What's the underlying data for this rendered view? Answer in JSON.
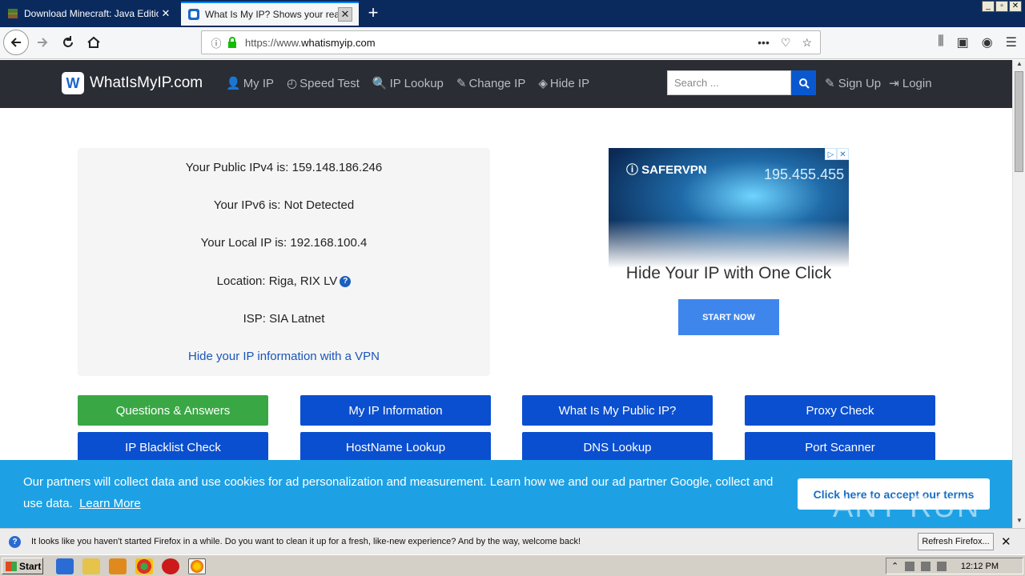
{
  "browser": {
    "tabs": [
      {
        "title": "Download Minecraft: Java Edition",
        "active": false
      },
      {
        "title": "What Is My IP? Shows your real pu",
        "active": true
      }
    ],
    "new_tab": "+",
    "url_prefix": "https://www.",
    "url_host": "whatismyip.com",
    "page_actions": "•••",
    "window_controls": [
      "_",
      "▫",
      "✕"
    ]
  },
  "site": {
    "logo_text": "WhatIsMyIP.com",
    "logo_mark": "W",
    "menu": [
      "My IP",
      "Speed Test",
      "IP Lookup",
      "Change IP",
      "Hide IP"
    ],
    "menu_icons": [
      "👤",
      "◴",
      "🔍",
      "✎",
      "◈"
    ],
    "search_placeholder": "Search ...",
    "sign_up": "Sign Up",
    "login": "Login"
  },
  "ip_info": {
    "ipv4": "Your Public IPv4 is: 159.148.186.246",
    "ipv6": "Your IPv6 is: Not Detected",
    "local_ip": "Your Local IP is: 192.168.100.4",
    "location": "Location: Riga, RIX LV",
    "location_help": "?",
    "isp": "ISP: SIA Latnet",
    "vpn_link": "Hide your IP information with a VPN"
  },
  "ad": {
    "brand": "ⓘ SAFERVPN",
    "number": "195.455.455",
    "headline": "Hide Your IP with One Click",
    "button": "START NOW",
    "corner": [
      "▷",
      "✕"
    ]
  },
  "tiles": [
    {
      "label": "Questions & Answers",
      "green": true
    },
    {
      "label": "My IP Information"
    },
    {
      "label": "What Is My Public IP?"
    },
    {
      "label": "Proxy Check"
    },
    {
      "label": "IP Blacklist Check"
    },
    {
      "label": "HostName Lookup"
    },
    {
      "label": "DNS Lookup"
    },
    {
      "label": "Port Scanner"
    }
  ],
  "cookie": {
    "message": "Our partners will collect data and use cookies for ad personalization and measurement. Learn how we and our ad partner Google, collect and use data.",
    "learn_more": "Learn More",
    "accept": "Click here to accept our terms"
  },
  "watermark": "ANY RUN",
  "notification": {
    "text": "It looks like you haven't started Firefox in a while. Do you want to clean it up for a fresh, like-new experience? And by the way, welcome back!",
    "button": "Refresh Firefox...",
    "close": "✕",
    "icon": "?"
  },
  "taskbar": {
    "start": "Start",
    "clock": "12:12 PM"
  }
}
